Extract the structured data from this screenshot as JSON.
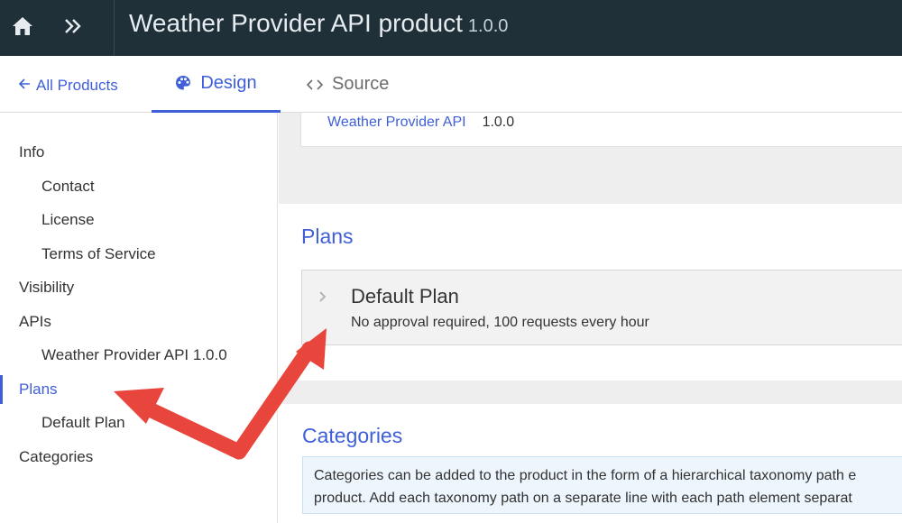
{
  "header": {
    "product_name": "Weather Provider API product",
    "product_version": "1.0.0",
    "home_icon": "home-icon",
    "expand_icon": "double-chevron-right-icon"
  },
  "tabs": {
    "back_label": "All Products",
    "design_label": "Design",
    "source_label": "Source"
  },
  "nav": {
    "info": "Info",
    "contact": "Contact",
    "license": "License",
    "terms": "Terms of Service",
    "visibility": "Visibility",
    "apis": "APIs",
    "api_item": "Weather Provider API 1.0.0",
    "plans": "Plans",
    "default_plan": "Default Plan",
    "categories": "Categories"
  },
  "apis_card": {
    "api_name": "Weather Provider API",
    "api_version": "1.0.0"
  },
  "plans_section": {
    "title": "Plans",
    "plan_name": "Default Plan",
    "plan_description": "No approval required, 100 requests every hour"
  },
  "categories_section": {
    "title": "Categories",
    "info_line1": "Categories can be added to the product in the form of a hierarchical taxonomy path e",
    "info_line2": "product. Add each taxonomy path on a separate line with each path element separat"
  },
  "colors": {
    "header_bg": "#1f3038",
    "accent": "#3f5fd9",
    "annotation_arrow": "#e8463c"
  }
}
